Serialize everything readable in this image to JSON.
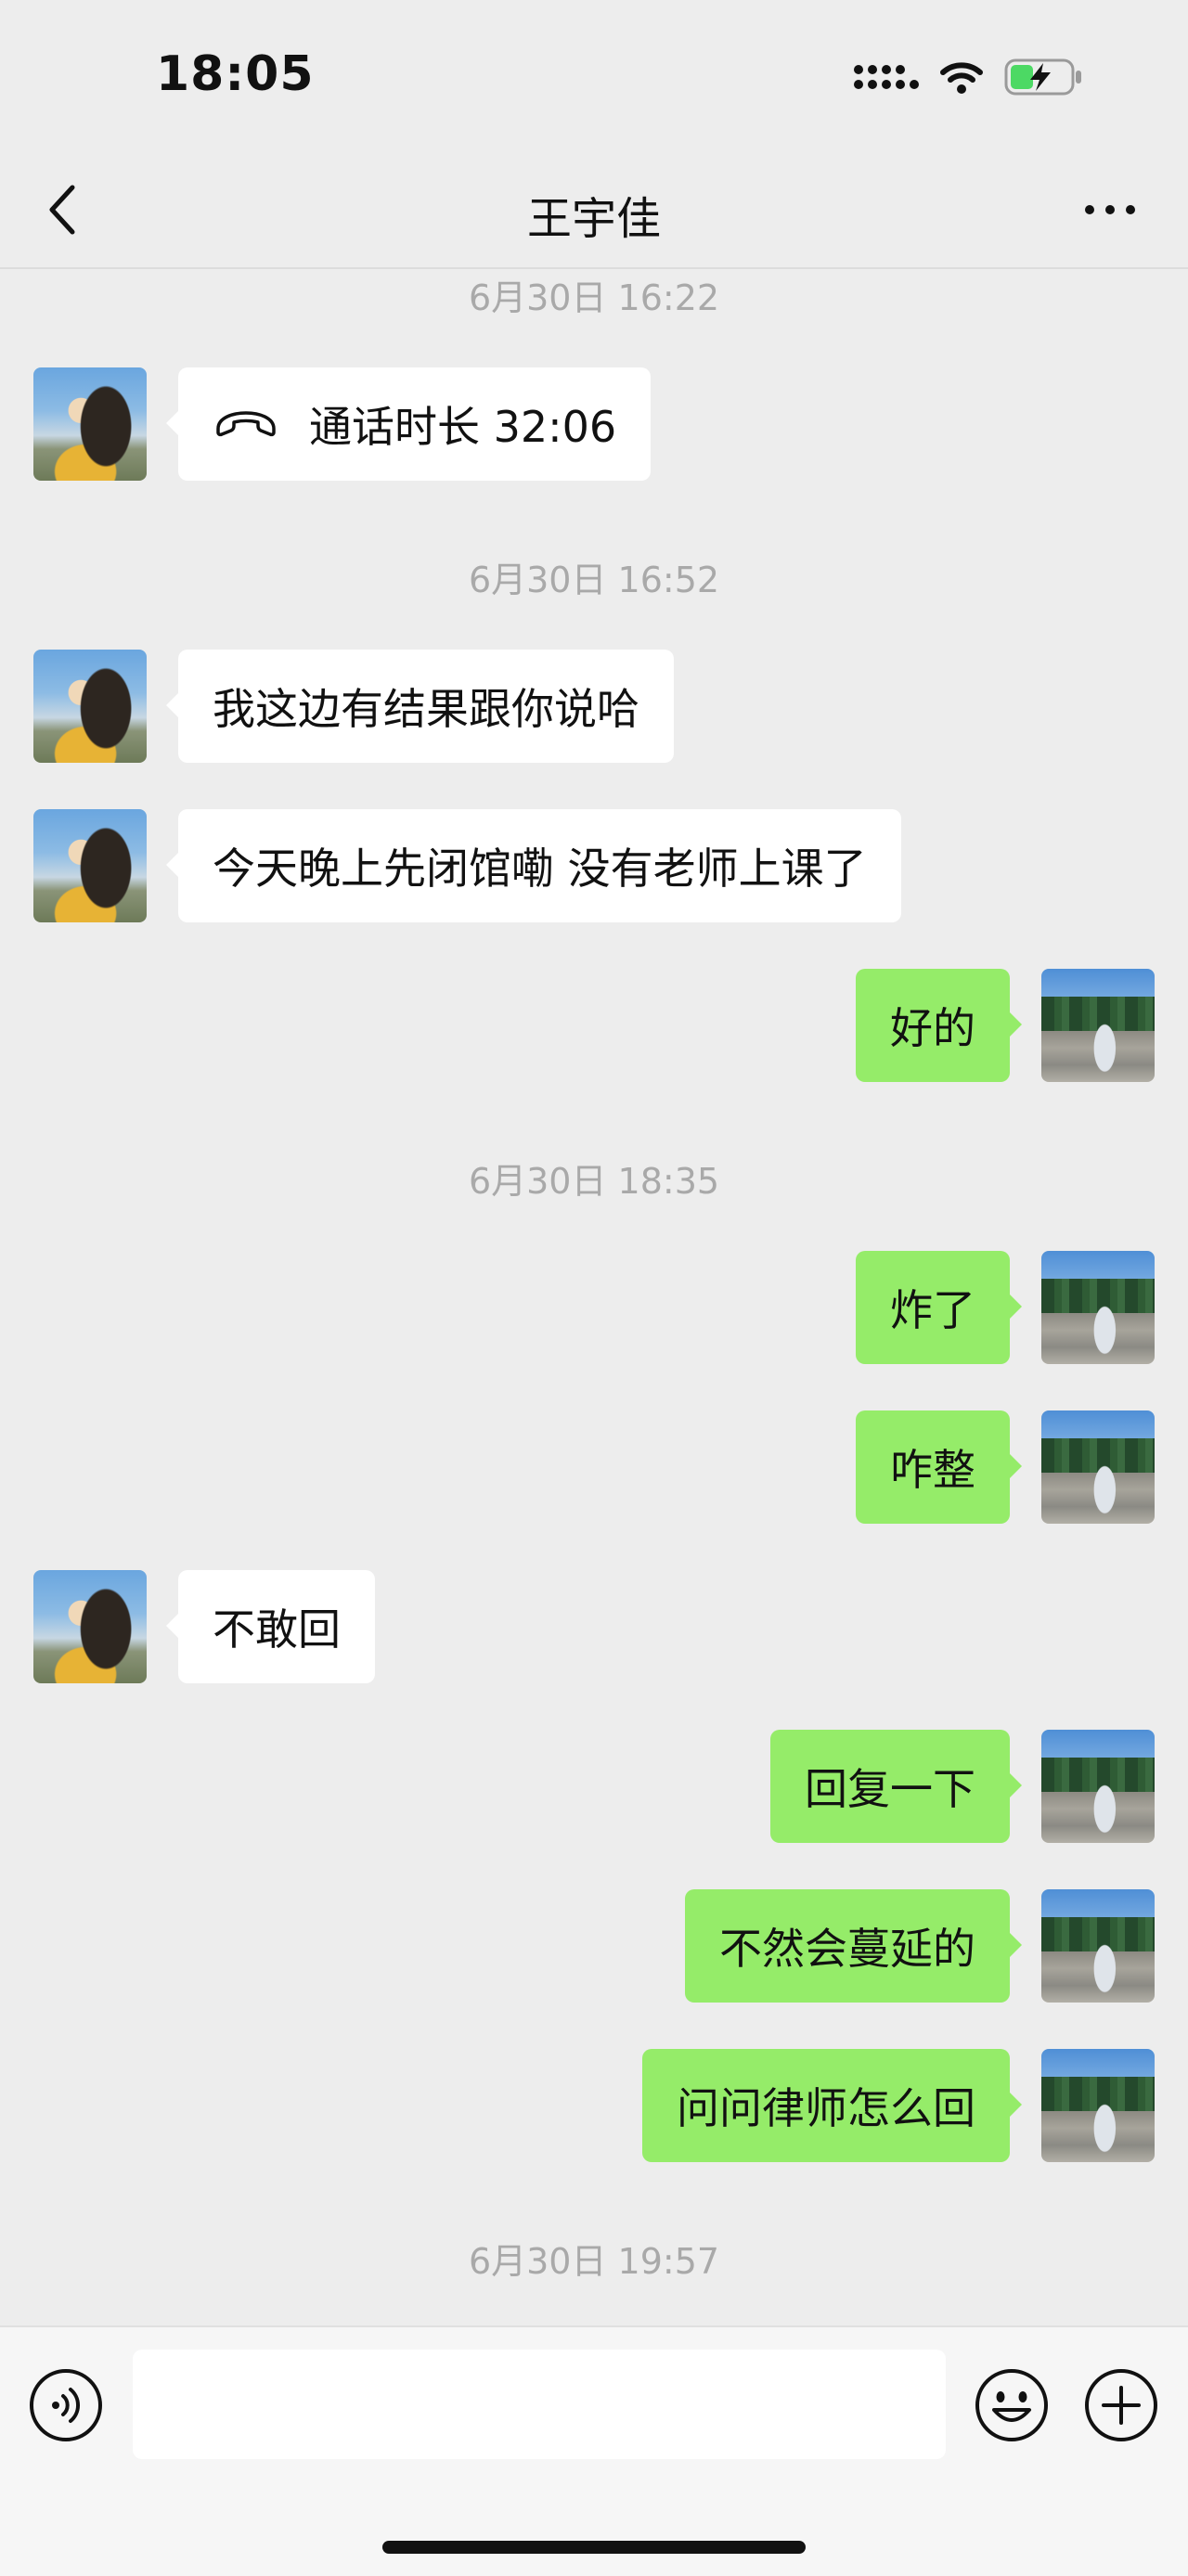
{
  "status_bar": {
    "time": "18:05",
    "icons": [
      "cellular-signal-icon",
      "wifi-icon",
      "battery-charging-icon"
    ],
    "battery_color": "#4cd964"
  },
  "header": {
    "title": "王宇佳",
    "back_icon": "chevron-left-icon",
    "more_icon": "more-dots-icon"
  },
  "timestamps": [
    "6月30日 16:22",
    "6月30日 16:52",
    "6月30日 18:35",
    "6月30日 19:57"
  ],
  "messages": [
    {
      "side": "incoming",
      "type": "call",
      "icon": "phone-hangup-icon",
      "text": "通话时长 32:06"
    },
    {
      "side": "incoming",
      "type": "text",
      "text": "我这边有结果跟你说哈"
    },
    {
      "side": "incoming",
      "type": "text",
      "text": "今天晚上先闭馆嘞 没有老师上课了"
    },
    {
      "side": "outgoing",
      "type": "text",
      "text": "好的"
    },
    {
      "side": "outgoing",
      "type": "text",
      "text": "炸了"
    },
    {
      "side": "outgoing",
      "type": "text",
      "text": "咋整"
    },
    {
      "side": "incoming",
      "type": "text",
      "text": "不敢回"
    },
    {
      "side": "outgoing",
      "type": "text",
      "text": "回复一下"
    },
    {
      "side": "outgoing",
      "type": "text",
      "text": "不然会蔓延的"
    },
    {
      "side": "outgoing",
      "type": "text",
      "text": "问问律师怎么回"
    }
  ],
  "colors": {
    "background": "#ededed",
    "incoming_bubble": "#ffffff",
    "outgoing_bubble": "#95ec69",
    "timestamp_text": "#a9a9a9"
  },
  "input_bar": {
    "message_value": "",
    "voice_icon": "voice-input-icon",
    "emoji_icon": "emoji-icon",
    "plus_icon": "plus-icon"
  }
}
